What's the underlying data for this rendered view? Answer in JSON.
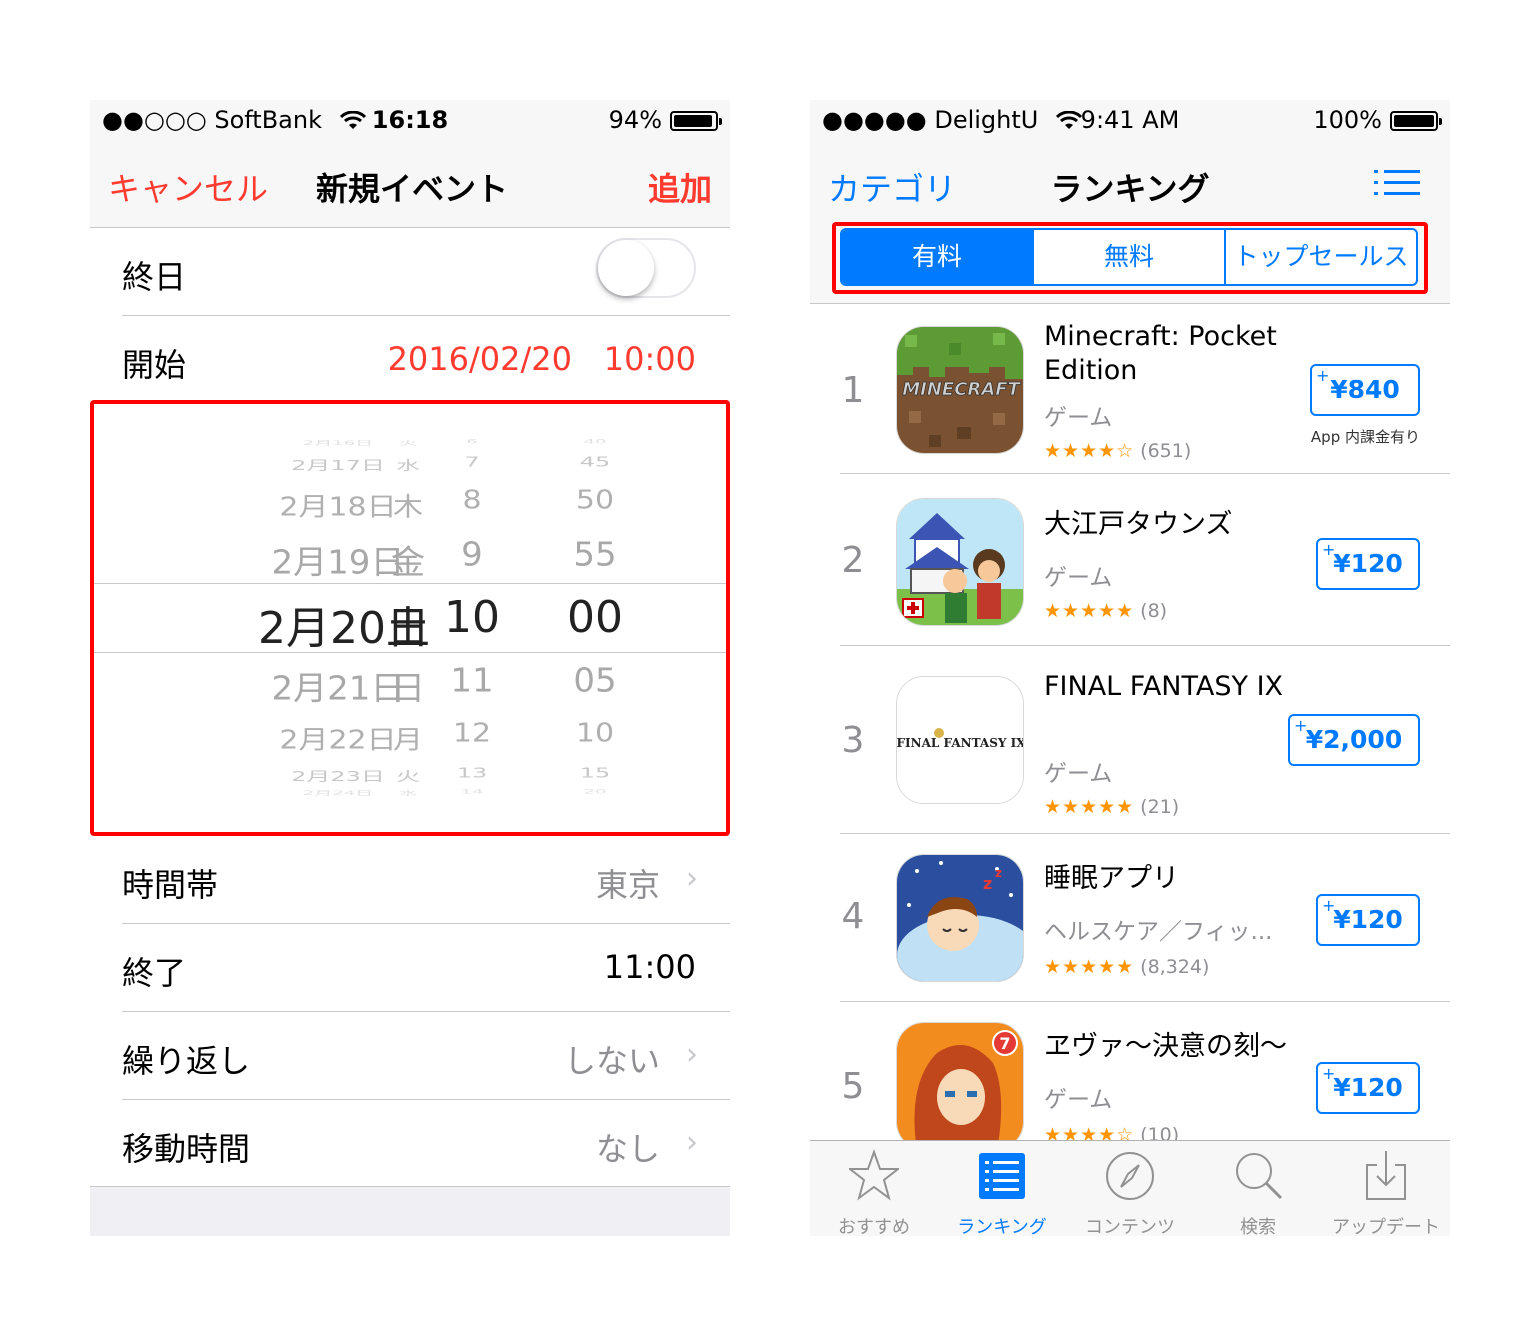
{
  "left": {
    "status": {
      "carrier": "●●○○○ SoftBank",
      "time": "16:18",
      "battery": "94%",
      "battery_level": 0.94
    },
    "nav": {
      "cancel": "キャンセル",
      "title": "新規イベント",
      "add": "追加"
    },
    "allday": {
      "label": "終日",
      "on": false
    },
    "start": {
      "label": "開始",
      "date": "2016/02/20",
      "time": "10:00"
    },
    "picker": {
      "rows": [
        {
          "date": "2月16日",
          "day": "火",
          "hour": "6",
          "min": "40"
        },
        {
          "date": "2月17日",
          "day": "水",
          "hour": "7",
          "min": "45"
        },
        {
          "date": "2月18日",
          "day": "木",
          "hour": "8",
          "min": "50"
        },
        {
          "date": "2月19日",
          "day": "金",
          "hour": "9",
          "min": "55"
        },
        {
          "date": "2月20日",
          "day": "土",
          "hour": "10",
          "min": "00"
        },
        {
          "date": "2月21日",
          "day": "日",
          "hour": "11",
          "min": "05"
        },
        {
          "date": "2月22日",
          "day": "月",
          "hour": "12",
          "min": "10"
        },
        {
          "date": "2月23日",
          "day": "火",
          "hour": "13",
          "min": "15"
        },
        {
          "date": "2月24日",
          "day": "水",
          "hour": "14",
          "min": "20"
        }
      ]
    },
    "timezone": {
      "label": "時間帯",
      "value": "東京"
    },
    "end": {
      "label": "終了",
      "value": "11:00"
    },
    "repeat": {
      "label": "繰り返し",
      "value": "しない"
    },
    "travel": {
      "label": "移動時間",
      "value": "なし"
    },
    "chevron": "›"
  },
  "right": {
    "status": {
      "carrier": "●●●●● DelightU",
      "time": "9:41 AM",
      "battery": "100%",
      "battery_level": 1.0
    },
    "nav": {
      "category": "カテゴリ",
      "title": "ランキング",
      "list_icon": "list-icon"
    },
    "segments": [
      "有料",
      "無料",
      "トップセールス"
    ],
    "active_segment": 0,
    "apps": [
      {
        "rank": "1",
        "name": "Minecraft: Pocket Edition",
        "category": "ゲーム",
        "stars": "★★★★☆",
        "count": "(651)",
        "price": "¥840",
        "plus": "+",
        "note": "App 内課金有り"
      },
      {
        "rank": "2",
        "name": "大江戸タウンズ",
        "category": "ゲーム",
        "stars": "★★★★★",
        "count": "(8)",
        "price": "¥120",
        "plus": "+"
      },
      {
        "rank": "3",
        "name": "FINAL FANTASY IX",
        "category": "ゲーム",
        "stars": "★★★★★",
        "count": "(21)",
        "price": "¥2,000",
        "plus": "+"
      },
      {
        "rank": "4",
        "name": "睡眠アプリ",
        "category": "ヘルスケア／フィッ...",
        "stars": "★★★★★",
        "count": "(8,324)",
        "price": "¥120",
        "plus": "+"
      },
      {
        "rank": "5",
        "name": "ヱヴァ～決意の刻～",
        "category": "ゲーム",
        "stars": "★★★★☆",
        "count": "(10)",
        "price": "¥120",
        "plus": "+"
      }
    ],
    "icon_text": {
      "minecraft": "MINECRAFT",
      "ff": "FINAL FANTASY IX"
    },
    "tabs": [
      {
        "label": "おすすめ",
        "icon": "star-icon"
      },
      {
        "label": "ランキング",
        "icon": "ranking-list-icon"
      },
      {
        "label": "コンテンツ",
        "icon": "compass-icon"
      },
      {
        "label": "検索",
        "icon": "search-icon"
      },
      {
        "label": "アップデート",
        "icon": "download-icon"
      }
    ],
    "active_tab": 1
  },
  "colors": {
    "ios_red": "#ff3b30",
    "ios_blue": "#007aff",
    "highlight_box": "#ff0000",
    "star": "#ff9500"
  }
}
